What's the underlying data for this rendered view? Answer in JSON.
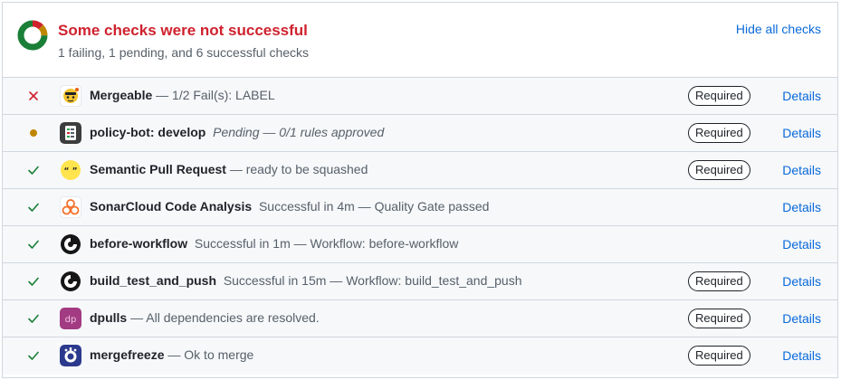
{
  "header": {
    "title": "Some checks were not successful",
    "subtitle": "1 failing, 1 pending, and 6 successful checks",
    "hide_label": "Hide all checks"
  },
  "colors": {
    "fail": "#cf222e",
    "pending": "#bf8700",
    "success": "#1a7f37",
    "link": "#0969da"
  },
  "checks": [
    {
      "status": "failure",
      "icon": "mergeable-bot-icon",
      "name": "Mergeable",
      "sep": " — ",
      "desc": "1/2 Fail(s): LABEL",
      "italic": false,
      "required_label": "Required",
      "details_label": "Details"
    },
    {
      "status": "pending",
      "icon": "policy-bot-icon",
      "name": "policy-bot: develop",
      "sep": "  ",
      "desc": "Pending — 0/1 rules approved",
      "italic": true,
      "required_label": "Required",
      "details_label": "Details"
    },
    {
      "status": "success",
      "icon": "quote-bubble-icon",
      "name": "Semantic Pull Request",
      "sep": " — ",
      "desc": "ready to be squashed",
      "italic": false,
      "required_label": "Required",
      "details_label": "Details"
    },
    {
      "status": "success",
      "icon": "sonarcloud-icon",
      "name": "SonarCloud Code Analysis",
      "sep": "  ",
      "desc": "Successful in 4m — Quality Gate passed",
      "italic": false,
      "required_label": "",
      "details_label": "Details"
    },
    {
      "status": "success",
      "icon": "circleci-icon",
      "name": "before-workflow",
      "sep": "  ",
      "desc": "Successful in 1m — Workflow: before-workflow",
      "italic": false,
      "required_label": "",
      "details_label": "Details"
    },
    {
      "status": "success",
      "icon": "circleci-icon",
      "name": "build_test_and_push",
      "sep": "  ",
      "desc": "Successful in 15m — Workflow: build_test_and_push",
      "italic": false,
      "required_label": "Required",
      "details_label": "Details"
    },
    {
      "status": "success",
      "icon": "dpulls-icon",
      "name": "dpulls",
      "sep": " — ",
      "desc": "All dependencies are resolved.",
      "italic": false,
      "required_label": "Required",
      "details_label": "Details"
    },
    {
      "status": "success",
      "icon": "mergefreeze-icon",
      "name": "mergefreeze",
      "sep": " — ",
      "desc": "Ok to merge",
      "italic": false,
      "required_label": "Required",
      "details_label": "Details"
    }
  ]
}
